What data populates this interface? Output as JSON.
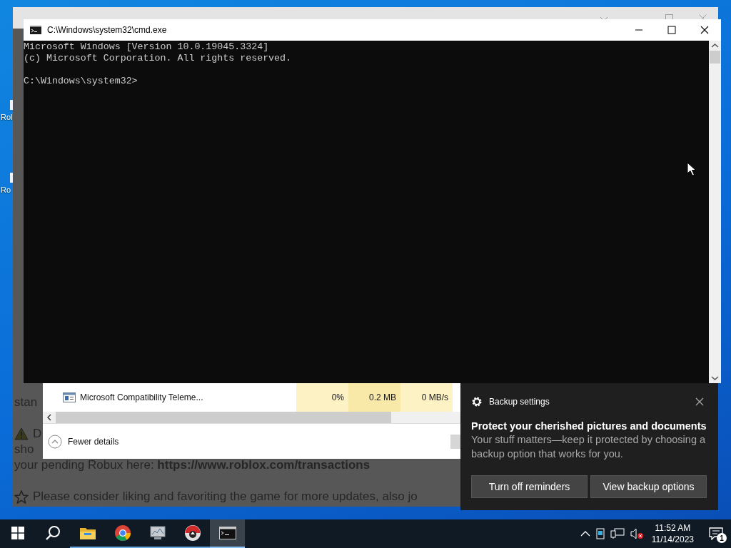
{
  "desktop_icons": [
    {
      "label": "Rol"
    },
    {
      "label": "Ro"
    }
  ],
  "background_page": {
    "rows": [
      {
        "kind": "plain",
        "text": "stan"
      },
      {
        "kind": "warning",
        "text": "D"
      },
      {
        "kind": "plain",
        "text": "sho"
      },
      {
        "kind": "plain",
        "text": "your pending Robux here: **https://www.roblox.com/transactions**"
      },
      {
        "kind": "star",
        "text": "Please consider liking and favoriting the game for more updates, also jo"
      }
    ]
  },
  "task_manager": {
    "row": {
      "name": "Microsoft Compatibility Teleme...",
      "cells": [
        "0%",
        "0.2 MB",
        "0 MB/s"
      ]
    },
    "details_button": "Fewer details"
  },
  "console": {
    "title": "C:\\Windows\\system32\\cmd.exe",
    "output": [
      "Microsoft Windows [Version 10.0.19045.3324]",
      "(c) Microsoft Corporation. All rights reserved."
    ],
    "prompt": "C:\\Windows\\system32>"
  },
  "notification": {
    "app": "Backup settings",
    "heading": "Protect your cherished pictures and documents",
    "body": "Your stuff matters—keep it protected by choosing a backup option that works for you.",
    "buttons": [
      "Turn off reminders",
      "View backup options"
    ]
  },
  "taskbar": {
    "apps": [
      {
        "kind": "start",
        "running": false,
        "selected": false
      },
      {
        "kind": "search",
        "running": false,
        "selected": false
      },
      {
        "kind": "folder",
        "running": true,
        "selected": false
      },
      {
        "kind": "chrome",
        "running": true,
        "selected": false
      },
      {
        "kind": "monitor",
        "running": true,
        "selected": false
      },
      {
        "kind": "game",
        "running": true,
        "selected": false
      },
      {
        "kind": "terminal",
        "running": true,
        "selected": true
      }
    ],
    "time": "11:52 AM",
    "date": "11/14/2023",
    "notification_count": "1"
  }
}
